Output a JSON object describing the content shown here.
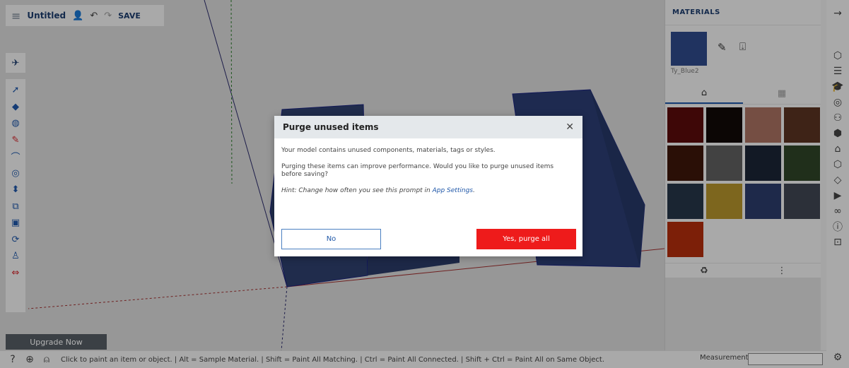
{
  "topbar": {
    "menu_icon": "hamburger-icon",
    "title": "Untitled",
    "save_label": "SAVE"
  },
  "left_toolbar": {
    "tools": [
      {
        "name": "select-tool",
        "glyph": "➚"
      },
      {
        "name": "eraser-tool",
        "glyph": "◆"
      },
      {
        "name": "paint-bucket-tool",
        "glyph": "◍"
      },
      {
        "name": "pencil-tool",
        "glyph": "✎"
      },
      {
        "name": "arc-tool",
        "glyph": "⌒"
      },
      {
        "name": "circle-tool",
        "glyph": "◎"
      },
      {
        "name": "push-pull-tool",
        "glyph": "⬍"
      },
      {
        "name": "offset-tool",
        "glyph": "⧉"
      },
      {
        "name": "section-plane-tool",
        "glyph": "▣"
      },
      {
        "name": "orbit-tool",
        "glyph": "⟳"
      },
      {
        "name": "walk-tool",
        "glyph": "♙"
      },
      {
        "name": "dimension-tool",
        "glyph": "⇔"
      }
    ]
  },
  "upgrade_label": "Upgrade Now",
  "materials": {
    "header": "MATERIALS",
    "current_name": "Ty_Blue2",
    "current_color": "#2f4a8a",
    "swatches": [
      "#5a0b0b",
      "#120908",
      "#a87061",
      "#5a3322",
      "#3d1609",
      "#5f5f5f",
      "#1a2535",
      "#2e4428",
      "#263548",
      "#b3922c",
      "#2b3b6a",
      "#3f4552",
      "#b22d0c"
    ]
  },
  "statusbar": {
    "hint": "Click to paint an item or object. | Alt = Sample Material. | Shift = Paint All Matching. | Ctrl = Paint All Connected. | Shift + Ctrl = Paint All on Same Object.",
    "measurements_label": "Measurements",
    "measurements_value": ""
  },
  "dialog": {
    "title": "Purge unused items",
    "line1": "Your model contains unused components, materials, tags or styles.",
    "line2": "Purging these items can improve performance. Would you like to purge unused items before saving?",
    "hint_prefix": "Hint: Change how often you see this prompt in ",
    "hint_link": "App Settings",
    "hint_suffix": ".",
    "no_label": "No",
    "yes_label": "Yes, purge all"
  }
}
